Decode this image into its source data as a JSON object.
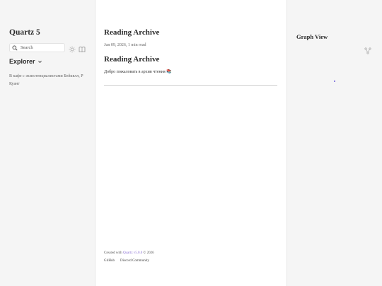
{
  "site": {
    "title": "Quartz 5"
  },
  "search": {
    "placeholder": "Search"
  },
  "explorer": {
    "label": "Explorer",
    "items": [
      "В кафе с экзистенциалистами Бейквлл, Р Куанг"
    ]
  },
  "article": {
    "title": "Reading Archive",
    "meta": "Jun 09, 2026,  1 min read",
    "heading": "Reading Archive",
    "paragraph": "Добро пожаловать в архив чтения 📚"
  },
  "footer": {
    "created_prefix": "Created with ",
    "quartz_link": "Quartz v5.0.0",
    "created_suffix": " © 2026",
    "links": [
      "GitHub",
      "Discord Community"
    ]
  },
  "graph": {
    "title": "Graph View",
    "node_color": "#6b5cd6"
  },
  "icons": {
    "search": "search-icon",
    "theme": "sun-icon",
    "reader": "book-icon",
    "explorer_toggle": "chevron-down-icon",
    "graph_global": "graph-icon"
  }
}
